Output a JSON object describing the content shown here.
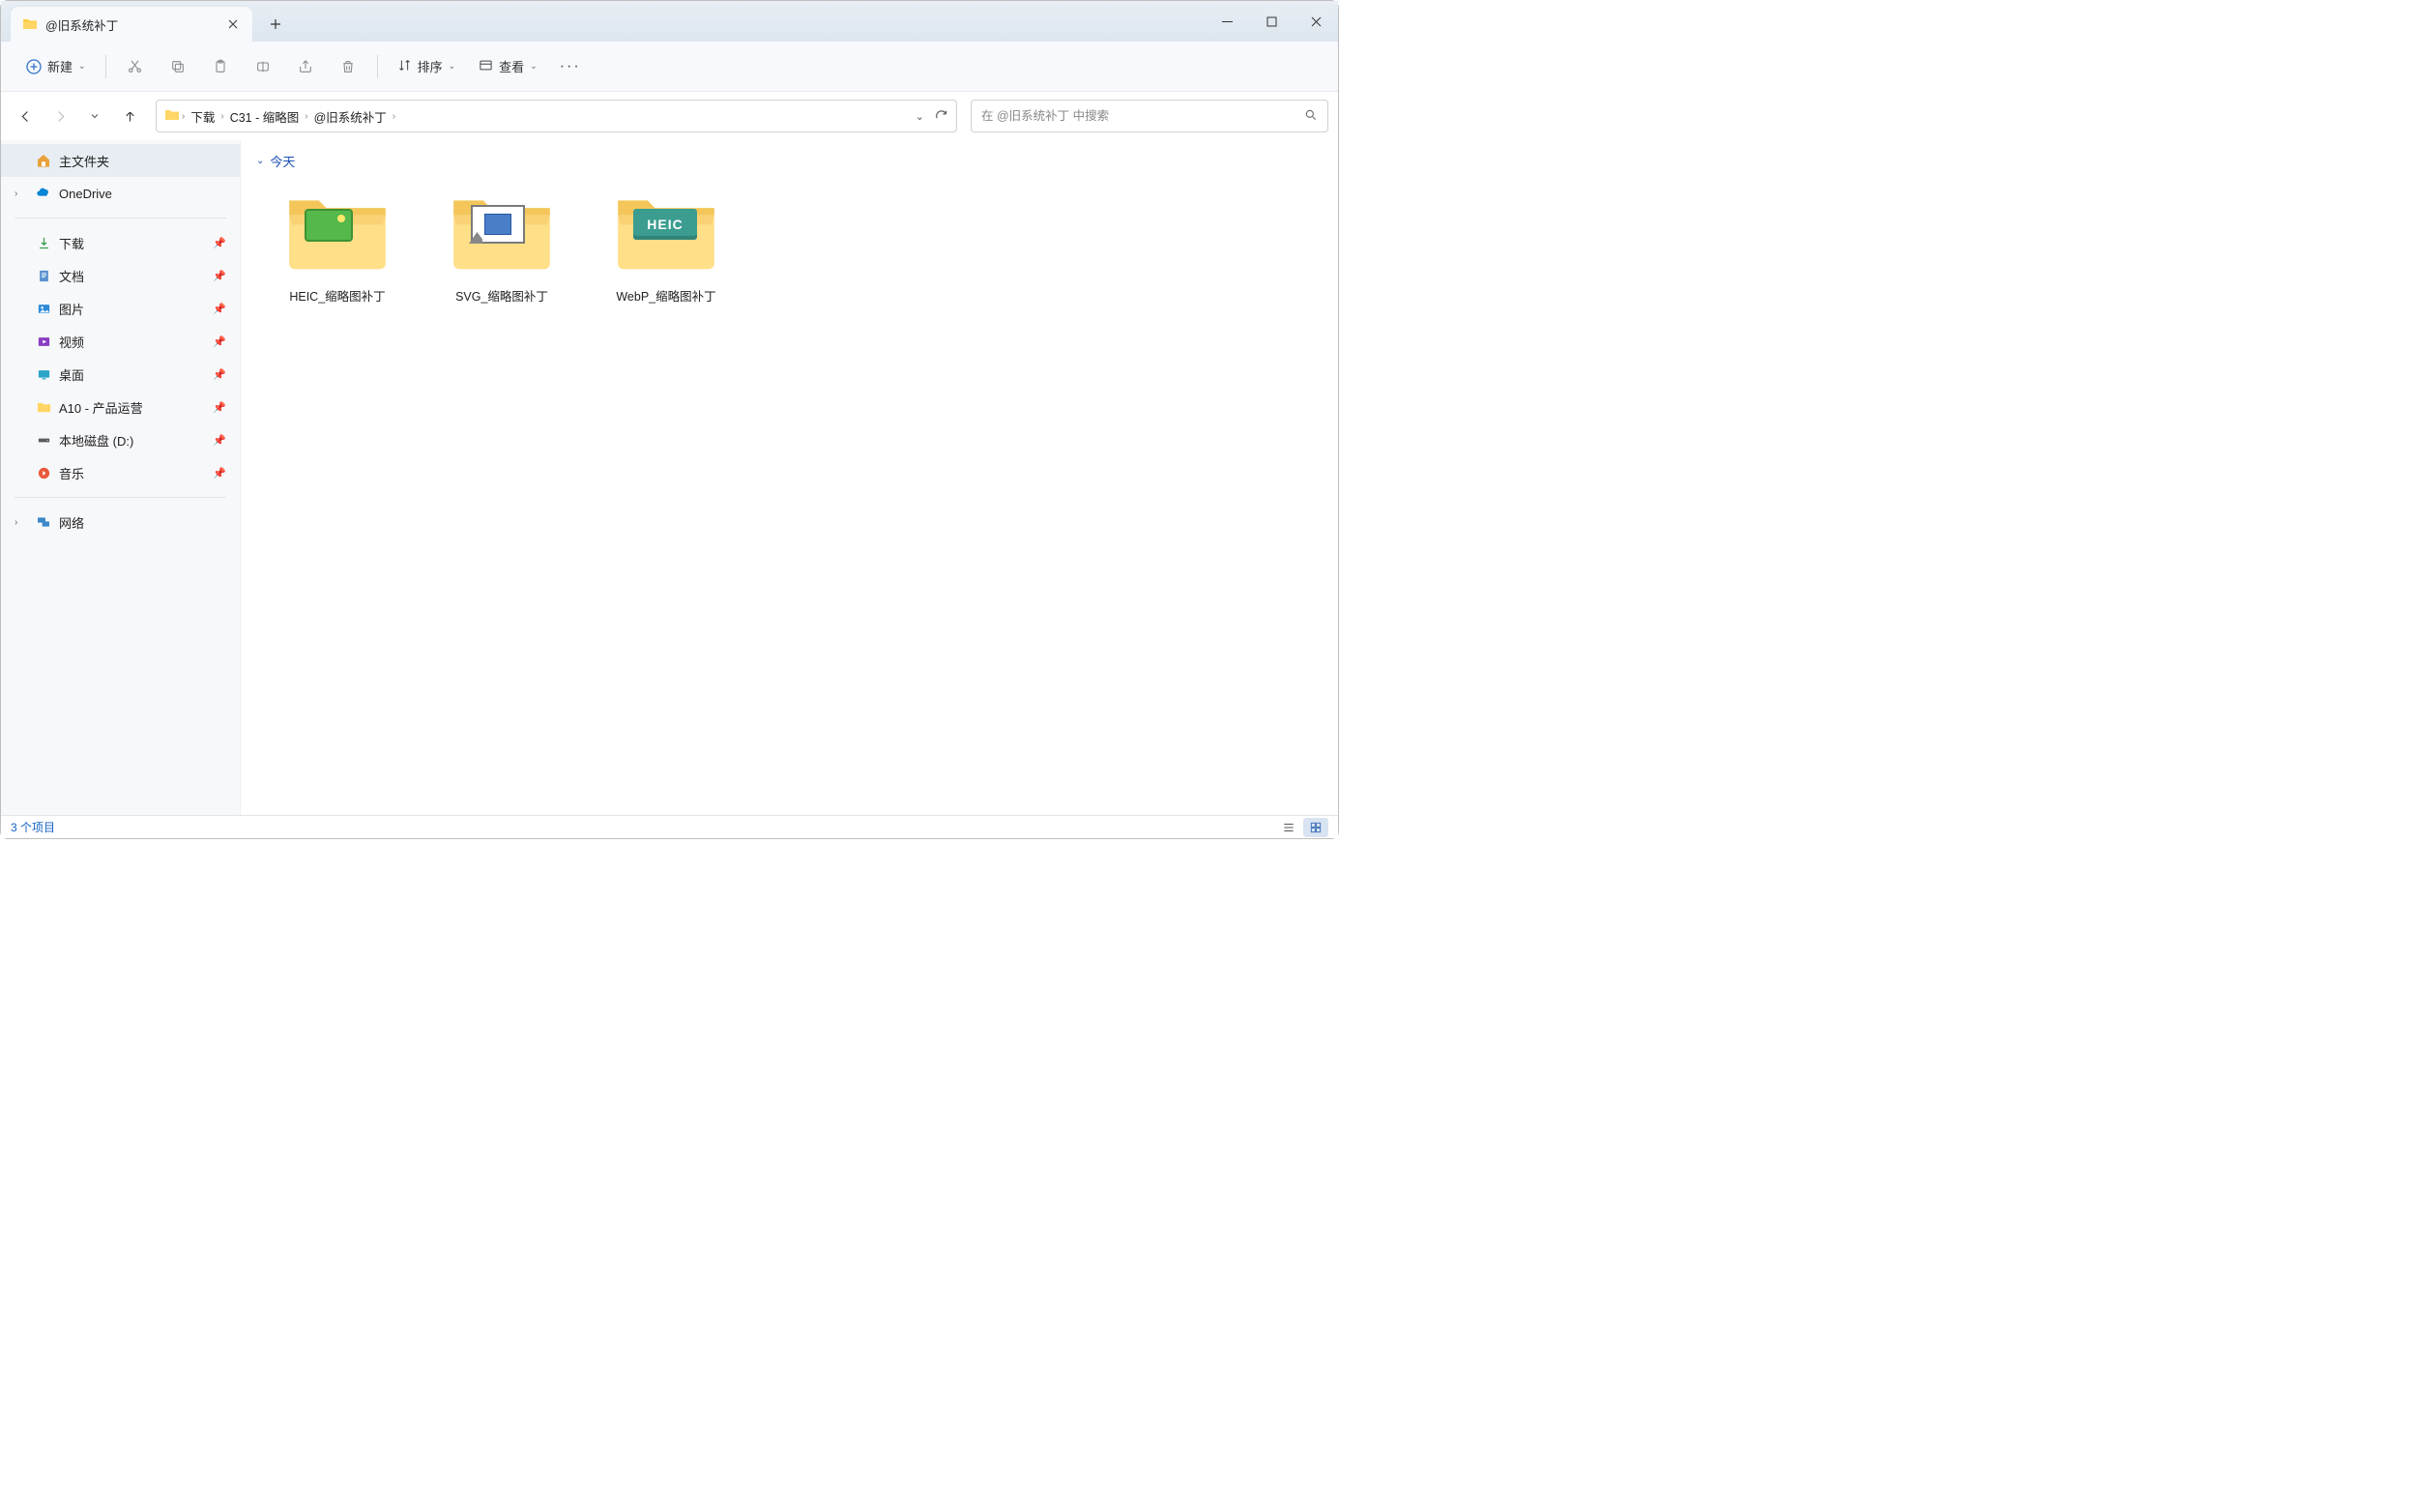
{
  "tab": {
    "title": "@旧系统补丁"
  },
  "toolbar": {
    "new_label": "新建",
    "sort_label": "排序",
    "view_label": "查看"
  },
  "breadcrumb": {
    "items": [
      "下载",
      "C31 - 缩略图",
      "@旧系统补丁"
    ]
  },
  "search": {
    "placeholder": "在 @旧系统补丁 中搜索"
  },
  "sidebar": {
    "home": "主文件夹",
    "onedrive": "OneDrive",
    "quick": {
      "downloads": "下载",
      "documents": "文档",
      "pictures": "图片",
      "videos": "视频",
      "desktop": "桌面",
      "a10": "A10 - 产品运营",
      "d_drive": "本地磁盘 (D:)",
      "music": "音乐"
    },
    "network": "网络"
  },
  "content": {
    "group_today": "今天",
    "items": [
      {
        "name": "HEIC_缩略图补丁"
      },
      {
        "name": "SVG_缩略图补丁"
      },
      {
        "name": "WebP_缩略图补丁"
      }
    ]
  },
  "status": {
    "text": "3 个项目"
  }
}
